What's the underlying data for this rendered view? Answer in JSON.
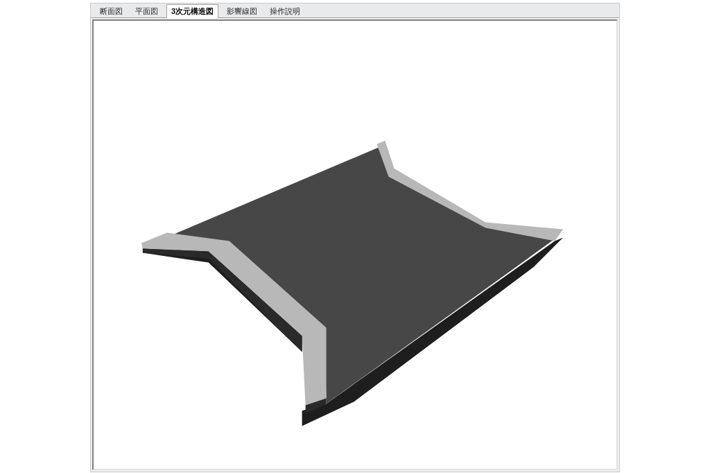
{
  "tabs": [
    {
      "label": "断面図",
      "selected": false
    },
    {
      "label": "平面図",
      "selected": false
    },
    {
      "label": "3次元構造図",
      "selected": true
    },
    {
      "label": "影響線図",
      "selected": false
    },
    {
      "label": "操作説明",
      "selected": false
    }
  ]
}
